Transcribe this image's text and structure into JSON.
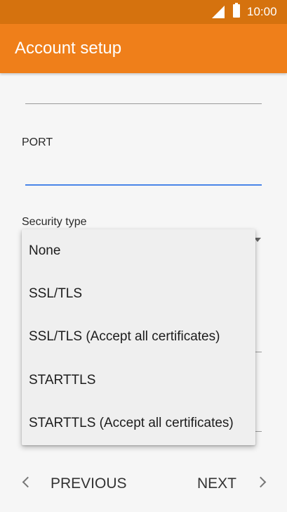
{
  "status_bar": {
    "time": "10:00"
  },
  "app_bar": {
    "title": "Account setup"
  },
  "form": {
    "port_label": "PORT",
    "port_value": "",
    "security_label": "Security type"
  },
  "security_menu": {
    "options": [
      "None",
      "SSL/TLS",
      "SSL/TLS (Accept all certificates)",
      "STARTTLS",
      "STARTTLS (Accept all certificates)"
    ]
  },
  "bottom_bar": {
    "previous_label": "PREVIOUS",
    "next_label": "NEXT"
  },
  "colors": {
    "status_bar": "#d5720e",
    "app_bar": "#ef7f1a",
    "focus_underline": "#4a86e8"
  }
}
